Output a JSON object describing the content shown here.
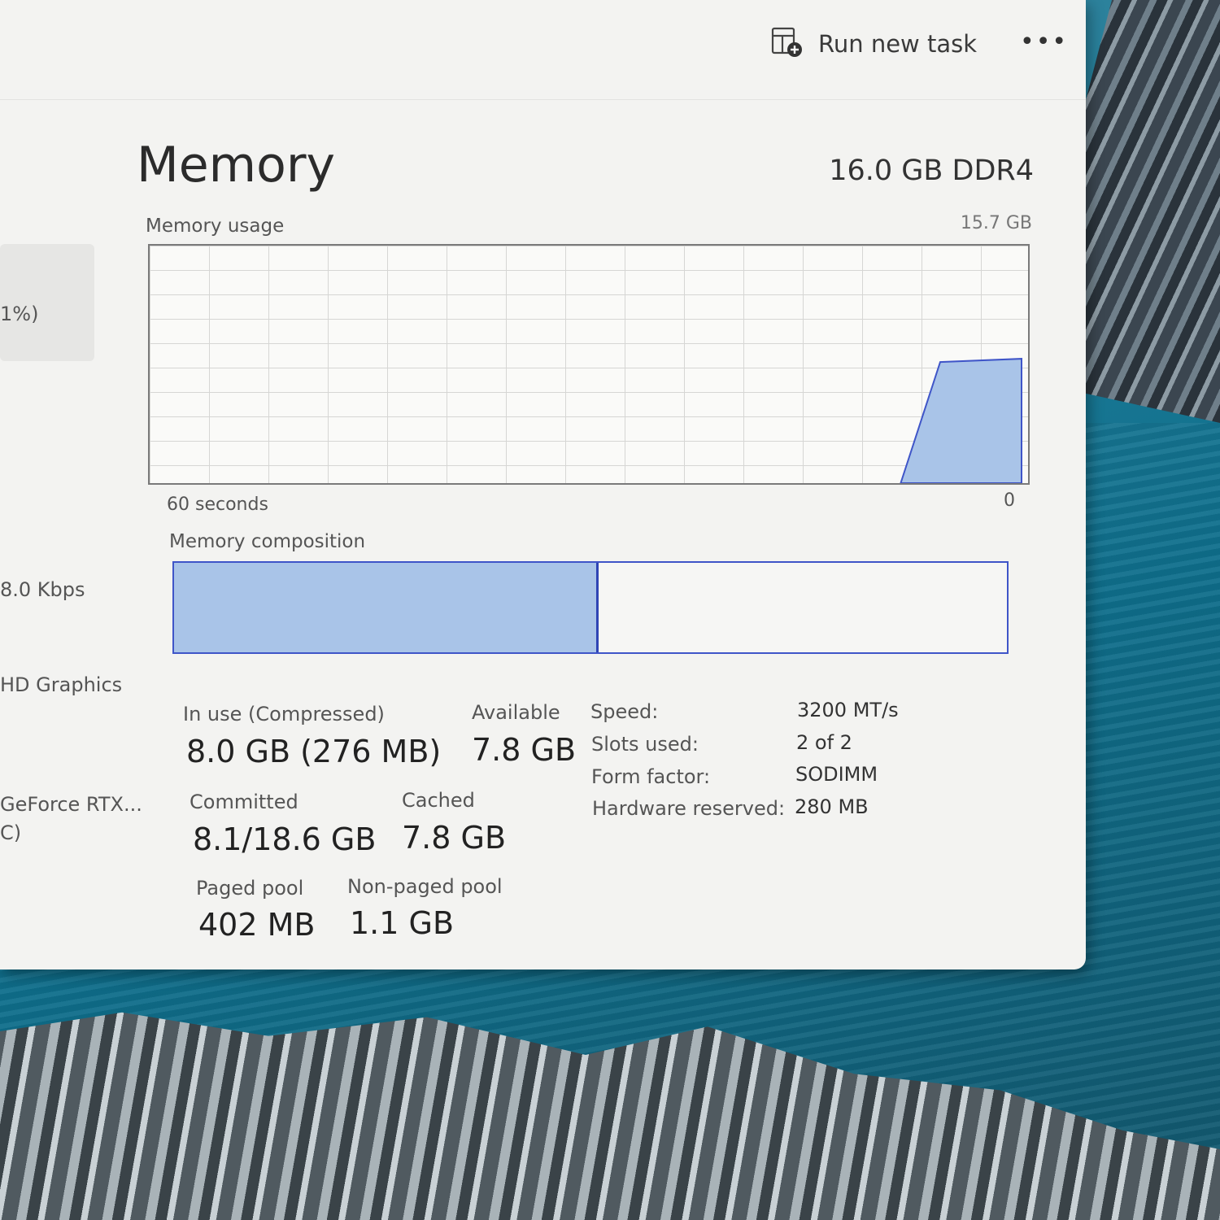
{
  "toolbar": {
    "run_new_task": "Run new task",
    "more": "•••"
  },
  "sidebar": {
    "items": [
      {
        "text": "1%)"
      },
      {
        "text": "8.0 Kbps"
      },
      {
        "text": "HD Graphics"
      },
      {
        "text": "GeForce RTX..."
      },
      {
        "text": "C)"
      }
    ]
  },
  "memory": {
    "title": "Memory",
    "spec": "16.0 GB DDR4",
    "usage_label": "Memory usage",
    "usage_max": "15.7 GB",
    "axis_left": "60 seconds",
    "axis_right": "0",
    "composition_label": "Memory composition",
    "in_use_fraction": 0.51,
    "graph_usage_fraction": 0.51,
    "stats": {
      "in_use_label": "In use (Compressed)",
      "in_use_value": "8.0 GB (276 MB)",
      "available_label": "Available",
      "available_value": "7.8 GB",
      "committed_label": "Committed",
      "committed_value": "8.1/18.6 GB",
      "cached_label": "Cached",
      "cached_value": "7.8 GB",
      "paged_pool_label": "Paged pool",
      "paged_pool_value": "402 MB",
      "non_paged_pool_label": "Non-paged pool",
      "non_paged_pool_value": "1.1 GB"
    },
    "properties": [
      {
        "label": "Speed:",
        "value": "3200 MT/s"
      },
      {
        "label": "Slots used:",
        "value": "2 of 2"
      },
      {
        "label": "Form factor:",
        "value": "SODIMM"
      },
      {
        "label": "Hardware reserved:",
        "value": "280 MB"
      }
    ]
  },
  "colors": {
    "accent": "#3f55c8",
    "fill": "#a9c4e8"
  }
}
